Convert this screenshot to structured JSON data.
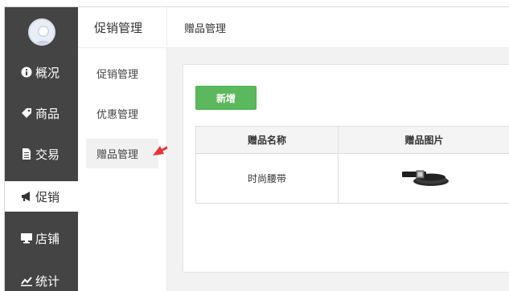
{
  "nav": {
    "items": [
      {
        "label": "概况",
        "icon": "info-circle-icon"
      },
      {
        "label": "商品",
        "icon": "tag-icon"
      },
      {
        "label": "交易",
        "icon": "document-icon"
      },
      {
        "label": "促销",
        "icon": "megaphone-icon"
      },
      {
        "label": "店铺",
        "icon": "monitor-icon"
      },
      {
        "label": "统计",
        "icon": "chart-line-icon"
      }
    ],
    "active_index": 3,
    "background": "#444444"
  },
  "submenu": {
    "title": "促销管理",
    "items": [
      {
        "label": "促销管理"
      },
      {
        "label": "优惠管理"
      },
      {
        "label": "赠品管理"
      }
    ],
    "active_index": 2
  },
  "main": {
    "header": "赠品管理",
    "add_button": "新增",
    "add_button_color": "#5cb85c",
    "table": {
      "columns": [
        "赠品名称",
        "赠品图片"
      ],
      "rows": [
        {
          "name": "时尚腰带",
          "image": "belt-image"
        }
      ]
    }
  },
  "annotation": {
    "arrow_color": "#e8333a"
  }
}
